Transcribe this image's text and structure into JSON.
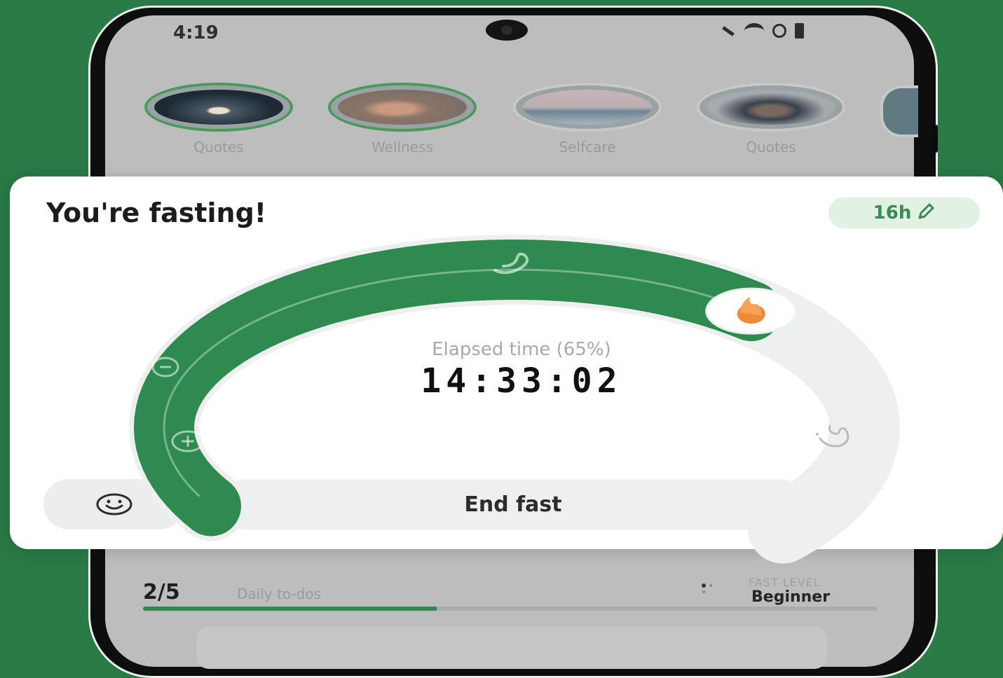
{
  "status_bar": {
    "time": "4:19",
    "icons": [
      "silent-icon",
      "wifi-icon",
      "do-not-disturb-icon",
      "battery-icon"
    ]
  },
  "stories": [
    {
      "label": "Quotes",
      "image": "lotus-image",
      "seen": false
    },
    {
      "label": "Wellness",
      "image": "woman-portrait-image",
      "seen": false
    },
    {
      "label": "Selfcare",
      "image": "feather-image",
      "seen": true
    },
    {
      "label": "Quotes",
      "image": "yoga-woman-image",
      "seen": true
    }
  ],
  "fasting_card": {
    "title": "You're fasting!",
    "goal": "16h",
    "elapsed_label": "Elapsed time (65%)",
    "elapsed_time": "14:33:02",
    "progress": 0.65,
    "end_button": "End fast",
    "stage_icons": [
      "drop-minus-icon",
      "drop-plus-icon",
      "stomach-icon",
      "flame-icon",
      "hand-flame-icon"
    ]
  },
  "todos": {
    "count": "2/5",
    "label": "Daily to-dos",
    "progress": 0.4
  },
  "fast_level": {
    "label": "FAST LEVEL",
    "value": "Beginner"
  },
  "colors": {
    "brand_green": "#2f8a4f",
    "background_green": "#2a7a46",
    "badge_bg": "#e2f2e2"
  }
}
